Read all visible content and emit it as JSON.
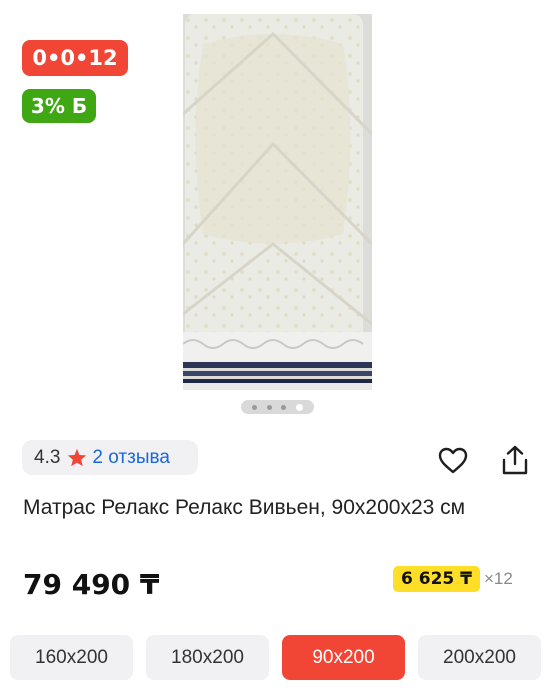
{
  "badges": {
    "installment": "0•0•12",
    "bonus": "3% Б"
  },
  "gallery": {
    "dots_count": 4,
    "active_index": 3
  },
  "rating": {
    "value": "4.3",
    "reviews_label": "2 отзыва",
    "star_color": "#f14635"
  },
  "product": {
    "title": "Матрас Релакс Релакс Вивьен, 90х200х23 см",
    "price": "79 490 ₸",
    "monthly_payment": "6 625 ₸",
    "months": "×12"
  },
  "sizes": [
    {
      "label": "160х200",
      "selected": false
    },
    {
      "label": "180х200",
      "selected": false
    },
    {
      "label": "90х200",
      "selected": true
    },
    {
      "label": "200х200",
      "selected": false
    }
  ],
  "colors": {
    "accent_red": "#f14635",
    "bonus_green": "#3fa614",
    "installment_yellow": "#ffde27",
    "link_blue": "#1a68d8"
  }
}
